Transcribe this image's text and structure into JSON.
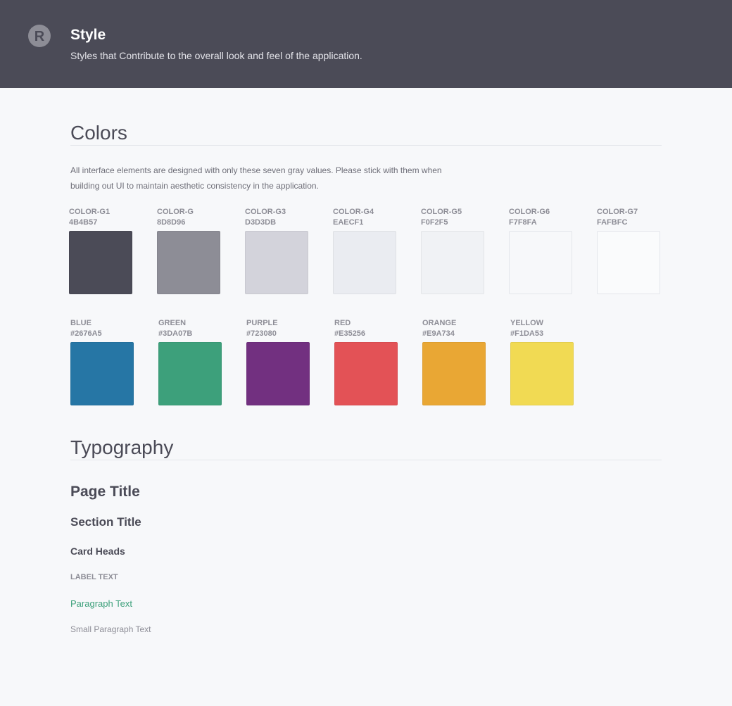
{
  "header": {
    "title": "Style",
    "subtitle": "Styles that Contribute to the overall look and feel of the application.",
    "logo_icon": "r-logo-icon"
  },
  "colors_section": {
    "heading": "Colors",
    "description": "All interface elements are designed with only these seven gray values. Please stick with them when building out UI to maintain aesthetic consistency in the application.",
    "grays": [
      {
        "name": "COLOR-G1",
        "hex": "4B4B57",
        "color": "#4B4B57"
      },
      {
        "name": "COLOR-G",
        "hex": "8D8D96",
        "color": "#8D8D96"
      },
      {
        "name": "COLOR-G3",
        "hex": "D3D3DB",
        "color": "#D3D3DB"
      },
      {
        "name": "COLOR-G4",
        "hex": "EAECF1",
        "color": "#EAECF1"
      },
      {
        "name": "COLOR-G5",
        "hex": "F0F2F5",
        "color": "#F0F2F5"
      },
      {
        "name": "COLOR-G6",
        "hex": "F7F8FA",
        "color": "#F7F8FA"
      },
      {
        "name": "COLOR-G7",
        "hex": "FAFBFC",
        "color": "#FAFBFC"
      }
    ],
    "accents": [
      {
        "name": "BLUE",
        "hex": "#2676A5",
        "color": "#2676A5"
      },
      {
        "name": "GREEN",
        "hex": "#3DA07B",
        "color": "#3DA07B"
      },
      {
        "name": "PURPLE",
        "hex": "#723080",
        "color": "#723080"
      },
      {
        "name": "RED",
        "hex": "#E35256",
        "color": "#E35256"
      },
      {
        "name": "ORANGE",
        "hex": "#E9A734",
        "color": "#E9A734"
      },
      {
        "name": "YELLOW",
        "hex": "#F1DA53",
        "color": "#F1DA53"
      }
    ]
  },
  "typography_section": {
    "heading": "Typography",
    "page_title": "Page Title",
    "section_title": "Section Title",
    "card_heads": "Card Heads",
    "label_text": "LABEL TEXT",
    "paragraph_text": "Paragraph Text",
    "small_paragraph_text": "Small Paragraph Text"
  }
}
